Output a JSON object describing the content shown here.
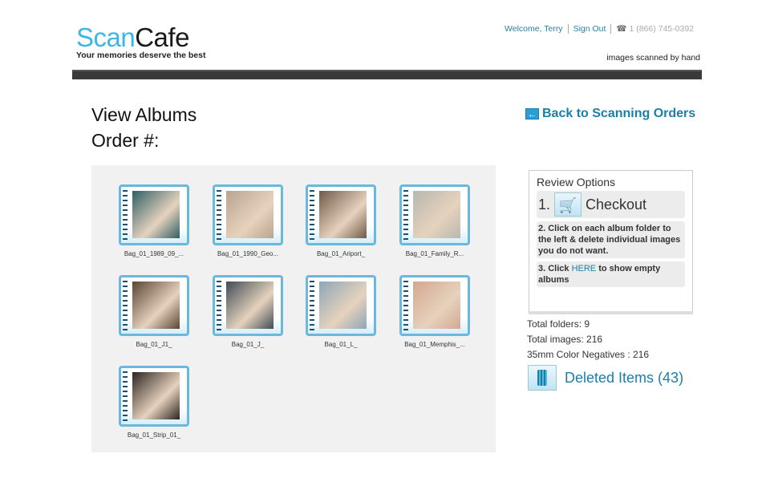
{
  "header": {
    "logo_scan": "Scan",
    "logo_cafe": "Cafe",
    "tagline": "Your memories deserve the best",
    "welcome": "Welcome, Terry",
    "sign_out": "Sign Out",
    "phone_icon": "☎",
    "phone": "1 (866) 745-0392",
    "scanned": "images scanned by hand"
  },
  "main": {
    "title": "View Albums",
    "order": "Order #:",
    "back_icon": "←",
    "back": "Back to Scanning Orders"
  },
  "albums": [
    {
      "label": "Bag_01_1989_09_...",
      "color": "#2d5f66"
    },
    {
      "label": "Bag_01_1990_Geo...",
      "color": "#b9a58e"
    },
    {
      "label": "Bag_01_Ariport_",
      "color": "#6f5a4a"
    },
    {
      "label": "Bag_01_Family_R...",
      "color": "#b8b8ae"
    },
    {
      "label": "Bag_01_J1_",
      "color": "#5a4433"
    },
    {
      "label": "Bag_01_J_",
      "color": "#3e4c55"
    },
    {
      "label": "Bag_01_L_",
      "color": "#8ea6b8"
    },
    {
      "label": "Bag_01_Memphis_...",
      "color": "#d3a890"
    },
    {
      "label": "Bag_01_Strip_01_",
      "color": "#2c2420"
    }
  ],
  "review": {
    "title": "Review Options",
    "step1_num": "1.",
    "cart_icon": "🛒",
    "checkout": "Checkout",
    "step2": "2. Click on each album folder to the left & delete individual images you do not want.",
    "step3_pre": "3. Click ",
    "step3_link": "HERE",
    "step3_post": " to show empty albums"
  },
  "stats": {
    "folders": "Total folders: 9",
    "images": "Total images: 216",
    "negatives": "35mm Color Negatives : 216"
  },
  "deleted": "Deleted Items (43)"
}
